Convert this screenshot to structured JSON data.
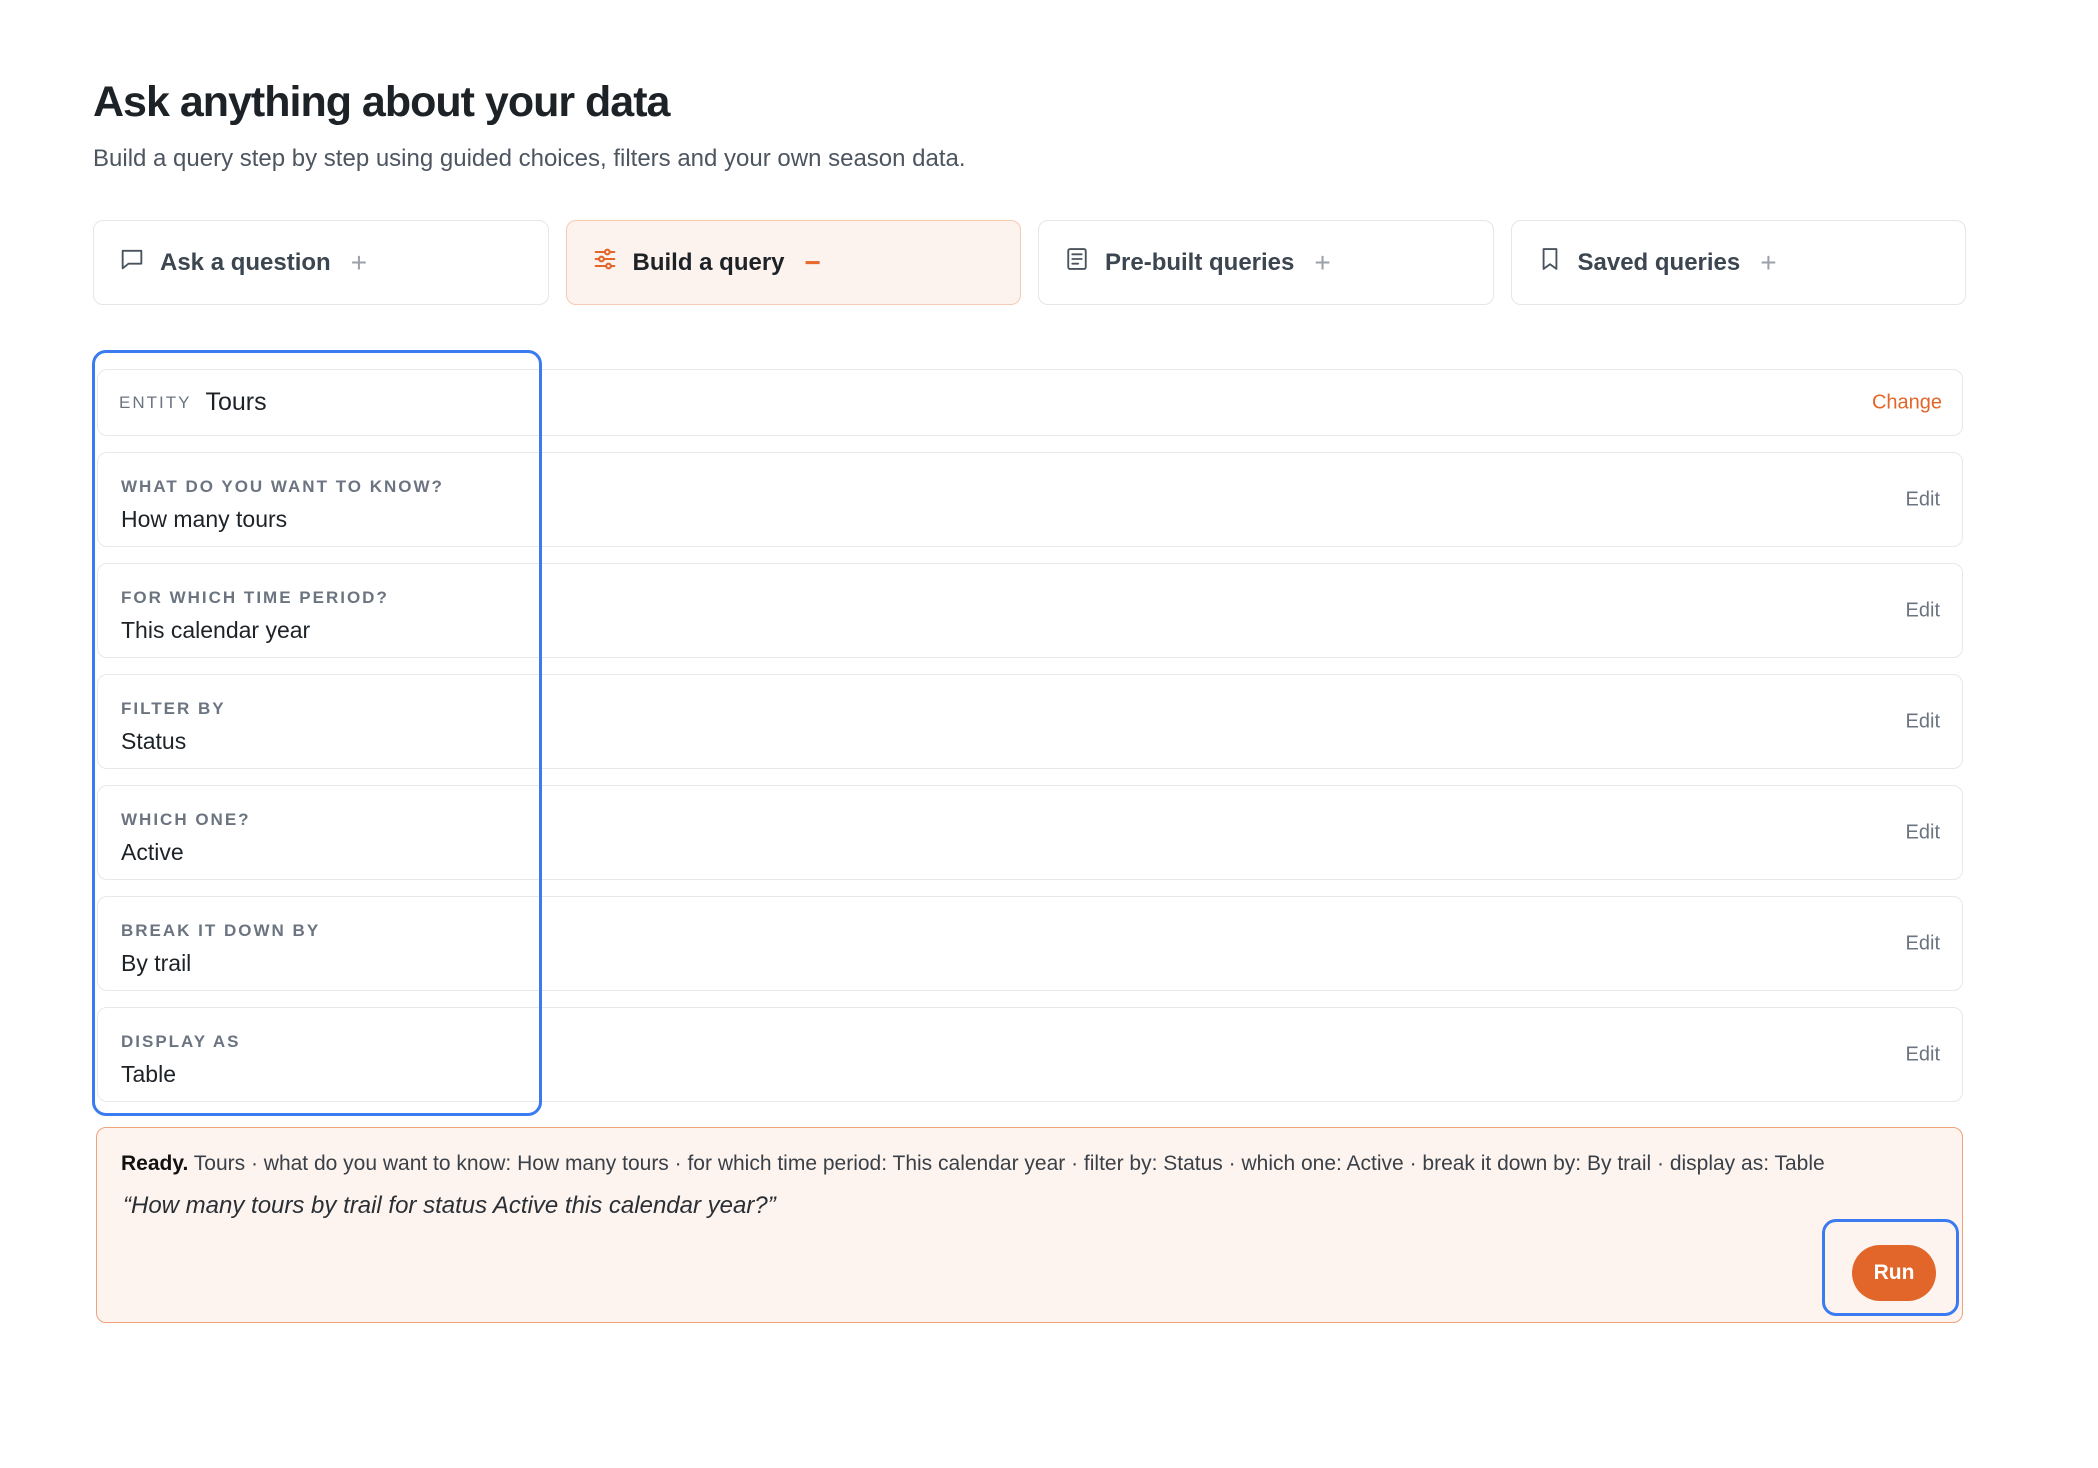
{
  "header": {
    "title": "Ask anything about your data",
    "subtitle": "Build a query step by step using guided choices, filters and your own season data."
  },
  "tabs": [
    {
      "label": "Ask a question",
      "icon": "chat-bubble-icon",
      "toggle": "+",
      "active": false
    },
    {
      "label": "Build a query",
      "icon": "sliders-icon",
      "toggle": "−",
      "active": true
    },
    {
      "label": "Pre-built queries",
      "icon": "document-icon",
      "toggle": "+",
      "active": false
    },
    {
      "label": "Saved queries",
      "icon": "bookmark-icon",
      "toggle": "+",
      "active": false
    }
  ],
  "entity": {
    "label": "ENTITY",
    "value": "Tours",
    "action": "Change"
  },
  "steps": [
    {
      "label": "What do you want to know?",
      "value": "How many tours",
      "action": "Edit"
    },
    {
      "label": "For which time period?",
      "value": "This calendar year",
      "action": "Edit"
    },
    {
      "label": "Filter by",
      "value": "Status",
      "action": "Edit"
    },
    {
      "label": "Which one?",
      "value": "Active",
      "action": "Edit"
    },
    {
      "label": "Break it down by",
      "value": "By trail",
      "action": "Edit"
    },
    {
      "label": "Display as",
      "value": "Table",
      "action": "Edit"
    }
  ],
  "summary": {
    "status": "Ready.",
    "text": " Tours · what do you want to know: How many tours · for which time period: This calendar year · filter by: Status · which one: Active · break it down by: By trail · display as: Table",
    "question": "“How many tours by trail for status Active this calendar year?”",
    "run_label": "Run"
  },
  "colors": {
    "accent": "#e2662a",
    "highlight": "#3b7bf0",
    "active_tab_bg": "#fdf3ee",
    "summary_bg": "#fdf4ef"
  }
}
